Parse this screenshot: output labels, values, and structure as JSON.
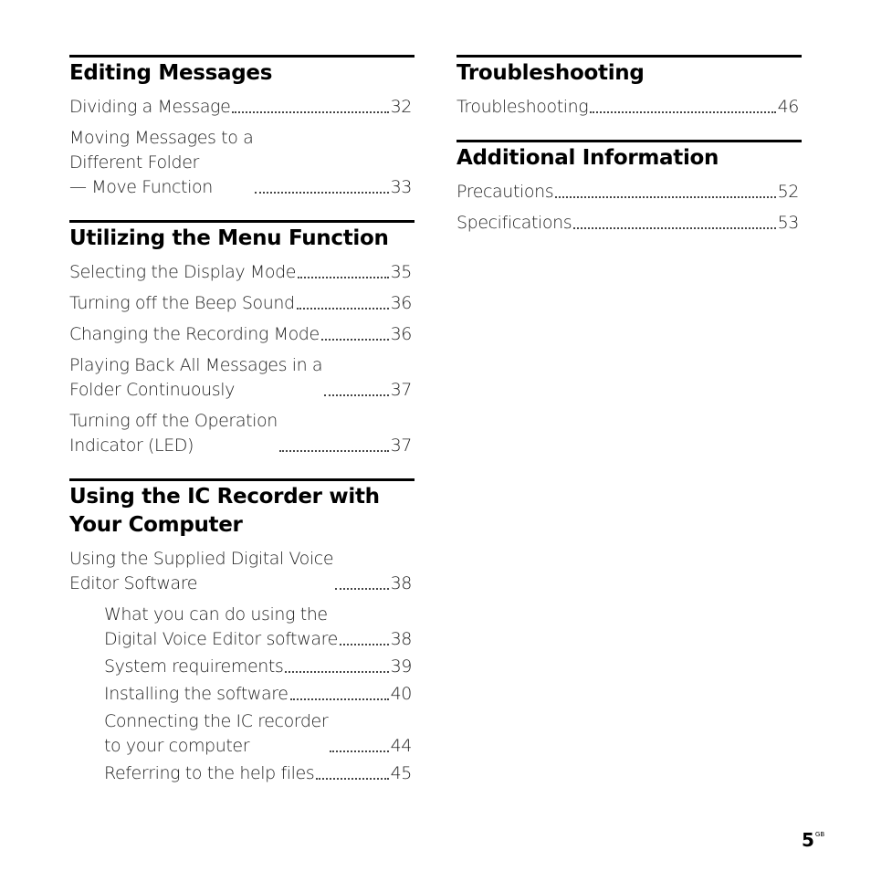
{
  "left_column": [
    {
      "heading": "Editing Messages",
      "entries": [
        {
          "text": "Dividing a Message",
          "page": "32",
          "sub": false
        },
        {
          "text": "Moving Messages to a\nDifferent Folder\n— Move Function",
          "page": "33",
          "sub": false
        }
      ]
    },
    {
      "heading": "Utilizing the Menu Function",
      "entries": [
        {
          "text": "Selecting the Display Mode",
          "page": "35",
          "sub": false
        },
        {
          "text": "Turning off the Beep Sound",
          "page": "36",
          "sub": false
        },
        {
          "text": "Changing the Recording Mode",
          "page": "36",
          "sub": false
        },
        {
          "text": "Playing Back All Messages in a\nFolder Continuously",
          "page": "37",
          "sub": false
        },
        {
          "text": "Turning off the Operation\nIndicator (LED)",
          "page": "37",
          "sub": false
        }
      ]
    },
    {
      "heading": "Using the IC Recorder with\nYour Computer",
      "entries": [
        {
          "text": "Using the Supplied Digital Voice\nEditor Software",
          "page": "38",
          "sub": false
        },
        {
          "text": "What you can do using the\nDigital Voice Editor software",
          "page": "38",
          "sub": true
        },
        {
          "text": "System requirements",
          "page": "39",
          "sub": true
        },
        {
          "text": "Installing the software",
          "page": "40",
          "sub": true
        },
        {
          "text": "Connecting the IC recorder\nto your computer",
          "page": "44",
          "sub": true
        },
        {
          "text": "Referring to the help files",
          "page": "45",
          "sub": true
        }
      ]
    }
  ],
  "right_column": [
    {
      "heading": "Troubleshooting",
      "entries": [
        {
          "text": "Troubleshooting",
          "page": "46",
          "sub": false
        }
      ]
    },
    {
      "heading": "Additional Information",
      "entries": [
        {
          "text": "Precautions",
          "page": "52",
          "sub": false
        },
        {
          "text": "Specifications",
          "page": "53",
          "sub": false
        }
      ]
    }
  ],
  "footer": {
    "page_number": "5",
    "region_code": "GB"
  }
}
